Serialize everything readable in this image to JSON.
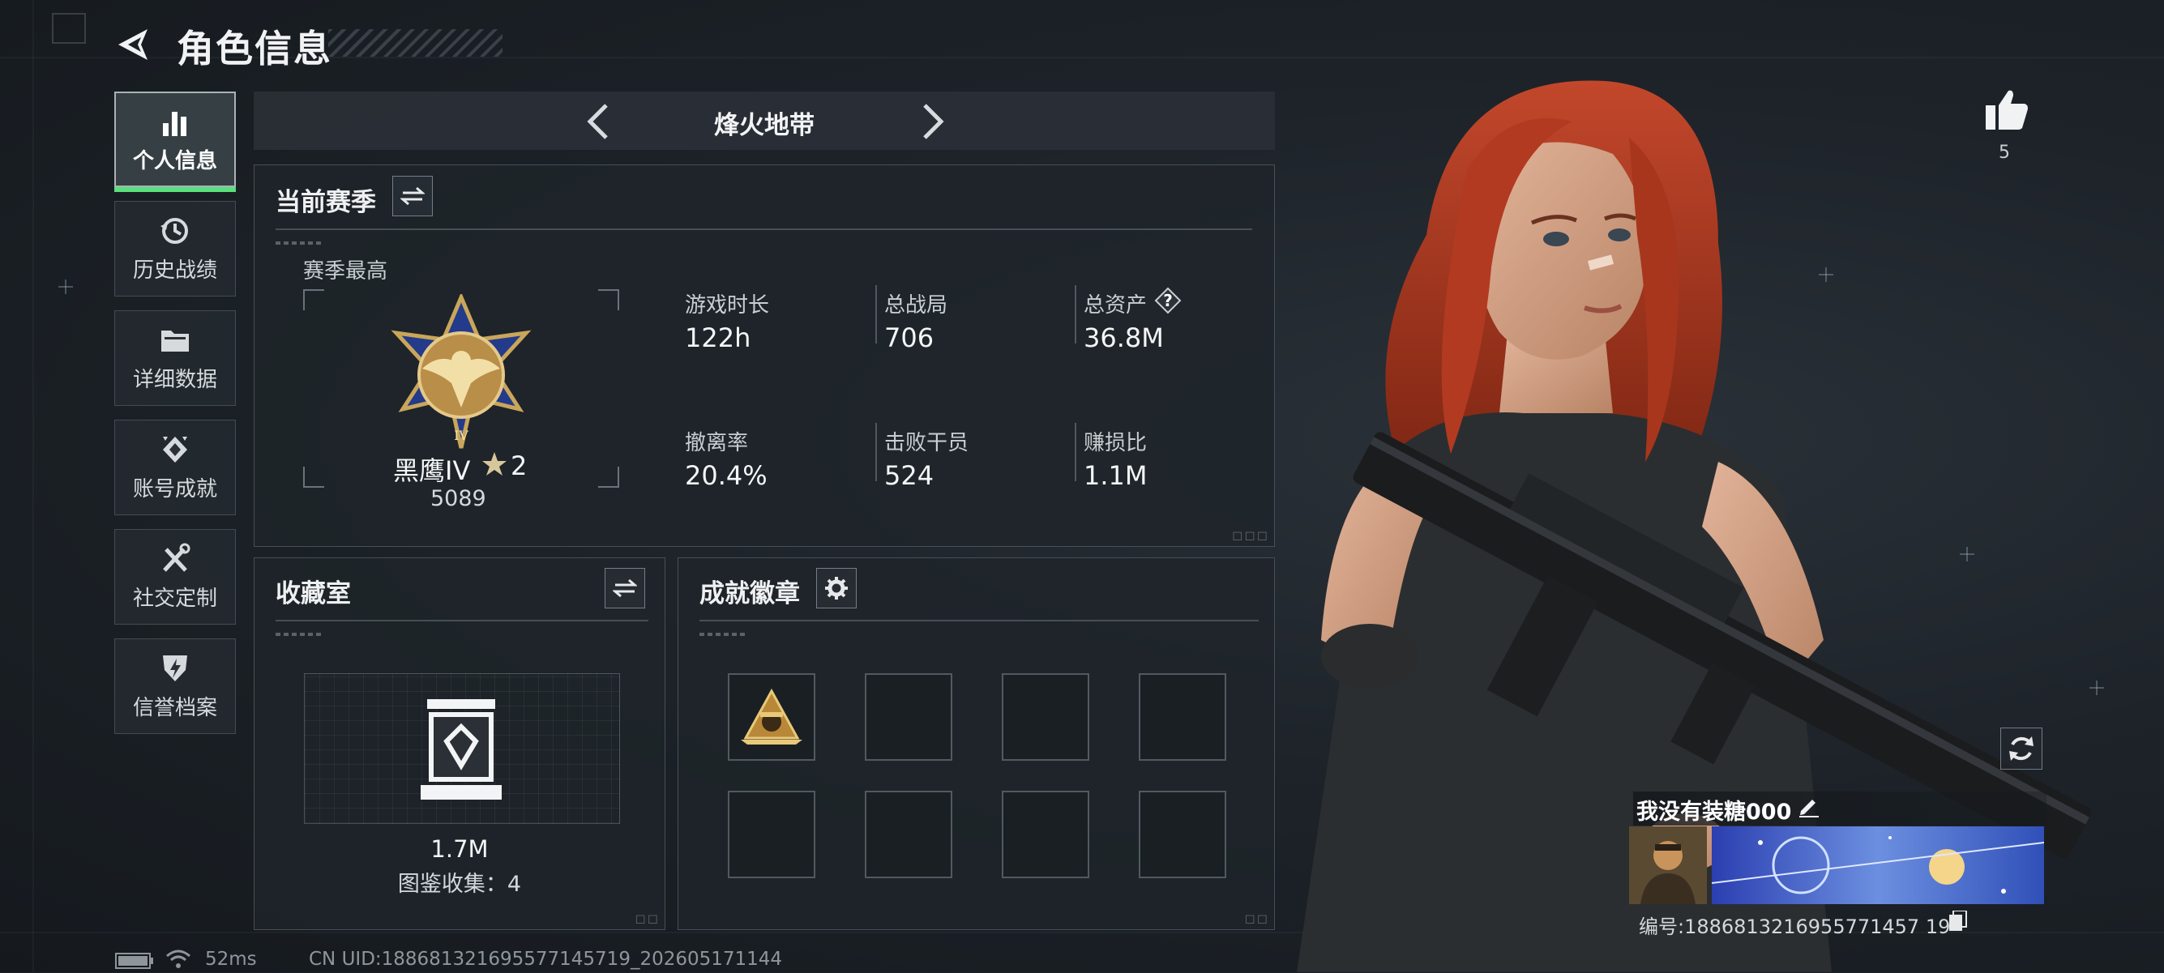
{
  "header": {
    "title": "角色信息"
  },
  "sidebar": {
    "items": [
      {
        "label": "个人信息",
        "icon": "bar-chart-icon",
        "active": true
      },
      {
        "label": "历史战绩",
        "icon": "history-icon",
        "active": false
      },
      {
        "label": "详细数据",
        "icon": "folder-icon",
        "active": false
      },
      {
        "label": "账号成就",
        "icon": "achievement-icon",
        "active": false
      },
      {
        "label": "社交定制",
        "icon": "tools-icon",
        "active": false
      },
      {
        "label": "信誉档案",
        "icon": "reputation-icon",
        "active": false
      }
    ]
  },
  "mode": {
    "title": "烽火地带"
  },
  "season": {
    "title": "当前赛季",
    "best_label": "赛季最高",
    "rank_name": "黑鹰IV",
    "rank_stars": "2",
    "rank_score": "5089",
    "stats": [
      {
        "label": "游戏时长",
        "value": "122h"
      },
      {
        "label": "总战局",
        "value": "706"
      },
      {
        "label": "总资产",
        "value": "36.8M"
      },
      {
        "label": "撤离率",
        "value": "20.4%"
      },
      {
        "label": "击败干员",
        "value": "524"
      },
      {
        "label": "赚损比",
        "value": "1.1M"
      }
    ],
    "help_glyph": "?"
  },
  "collection": {
    "title": "收藏室",
    "value": "1.7M",
    "count_text": "图鉴收集：4"
  },
  "badges": {
    "title": "成就徽章",
    "slots": 8,
    "filled": 1
  },
  "profile": {
    "likes": "5",
    "player_name": "我没有装糖000",
    "player_id": "编号:1886813216955771457 19"
  },
  "status": {
    "ping": "52ms",
    "uid": "CN UID:188681321695577145719_202605171144"
  },
  "colors": {
    "accent_green": "#58e07c",
    "panel": "#1e242a",
    "hair": "#b33a22"
  }
}
